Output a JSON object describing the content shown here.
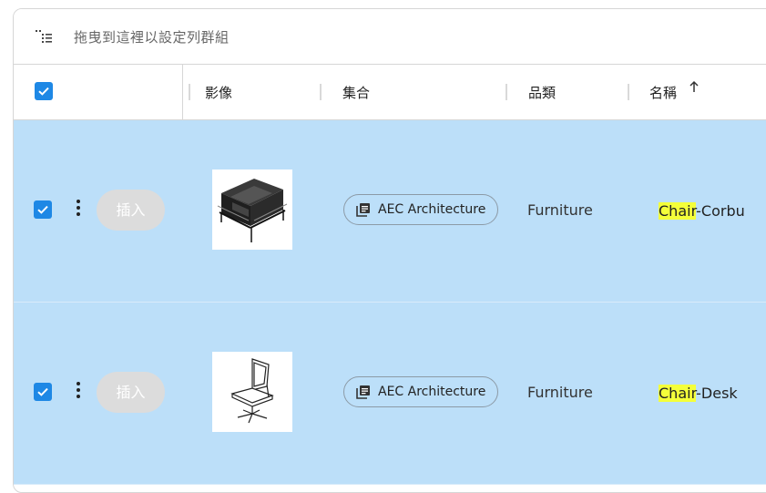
{
  "group_bar": {
    "icon": "group-by-icon",
    "hint": "拖曳到這裡以設定列群組"
  },
  "header": {
    "select_all_checked": true,
    "columns": [
      {
        "label": "影像"
      },
      {
        "label": "集合"
      },
      {
        "label": "品類"
      },
      {
        "label": "名稱",
        "sort": "ascending"
      }
    ]
  },
  "rows": [
    {
      "checked": true,
      "insert_label": "插入",
      "image": "lounge-armchair-thumbnail",
      "collection": "AEC Architecture",
      "category": "Furniture",
      "name_match": "Chair",
      "name_rest": "-Corbu"
    },
    {
      "checked": true,
      "insert_label": "插入",
      "image": "office-chair-thumbnail",
      "collection": "AEC Architecture",
      "category": "Furniture",
      "name_match": "Chair",
      "name_rest": "-Desk"
    }
  ],
  "colors": {
    "selected_row": "#bcdff9",
    "checkbox": "#1e88e5",
    "search_highlight": "#f4ff3a"
  }
}
